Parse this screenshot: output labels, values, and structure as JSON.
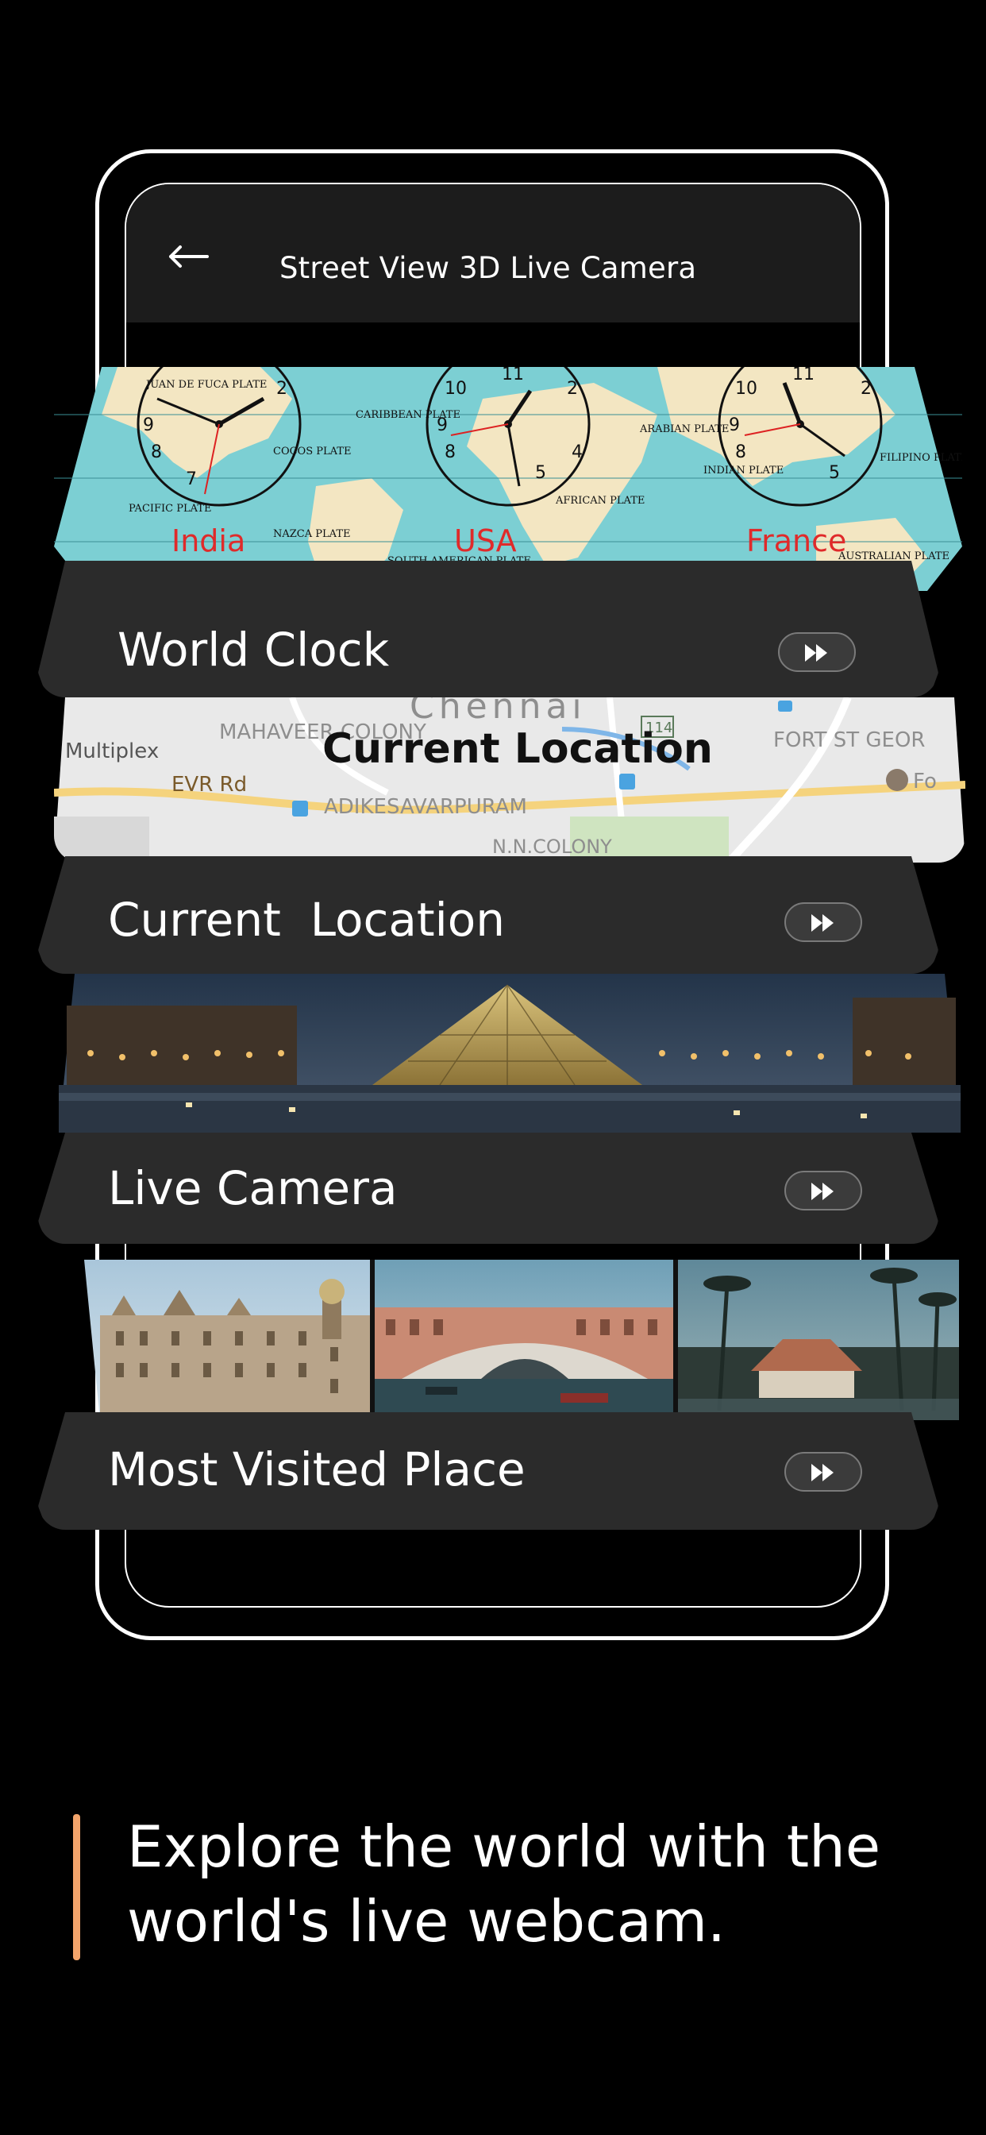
{
  "phone": {
    "title": "Street View 3D Live Camera",
    "back_icon": "arrow-left-icon"
  },
  "cards": {
    "world_clock": {
      "label": "World Clock",
      "clock_labels": [
        "India",
        "USA",
        "France"
      ],
      "plate_labels": [
        "JUAN DE FUCA PLATE",
        "CARIBBEAN PLATE",
        "COCOS PLATE",
        "PACIFIC PLATE",
        "NAZCA PLATE",
        "SOUTH AMERICAN PLATE",
        "AFRICAN PLATE",
        "ARABIAN PLATE",
        "INDIAN PLATE",
        "FILIPINO PLATE",
        "AUSTRALIAN PLATE"
      ],
      "button_icon": "fast-forward-icon"
    },
    "current_location": {
      "label": "Current  Location",
      "map_title": "Current Location",
      "map_labels": [
        "Chennai",
        "MAHAVEER COLONY",
        "Multiplex",
        "EVR Rd",
        "ADIKESAVARPURAM",
        "N.N.COLONY",
        "FORT ST GEOR",
        "Fo",
        "114"
      ],
      "button_icon": "fast-forward-icon"
    },
    "live_camera": {
      "label": "Live Camera",
      "button_icon": "fast-forward-icon"
    },
    "most_visited": {
      "label": "Most Visited Place",
      "button_icon": "fast-forward-icon"
    }
  },
  "tagline": {
    "line1": "Explore the world with the",
    "line2": "world's live webcam."
  },
  "colors": {
    "background": "#000000",
    "card_base": "#2b2b2b",
    "accent": "#f2a46b",
    "clock_label": "#e02a2a",
    "map_water": "#7ccfd3",
    "map_land": "#f3e6c2"
  }
}
